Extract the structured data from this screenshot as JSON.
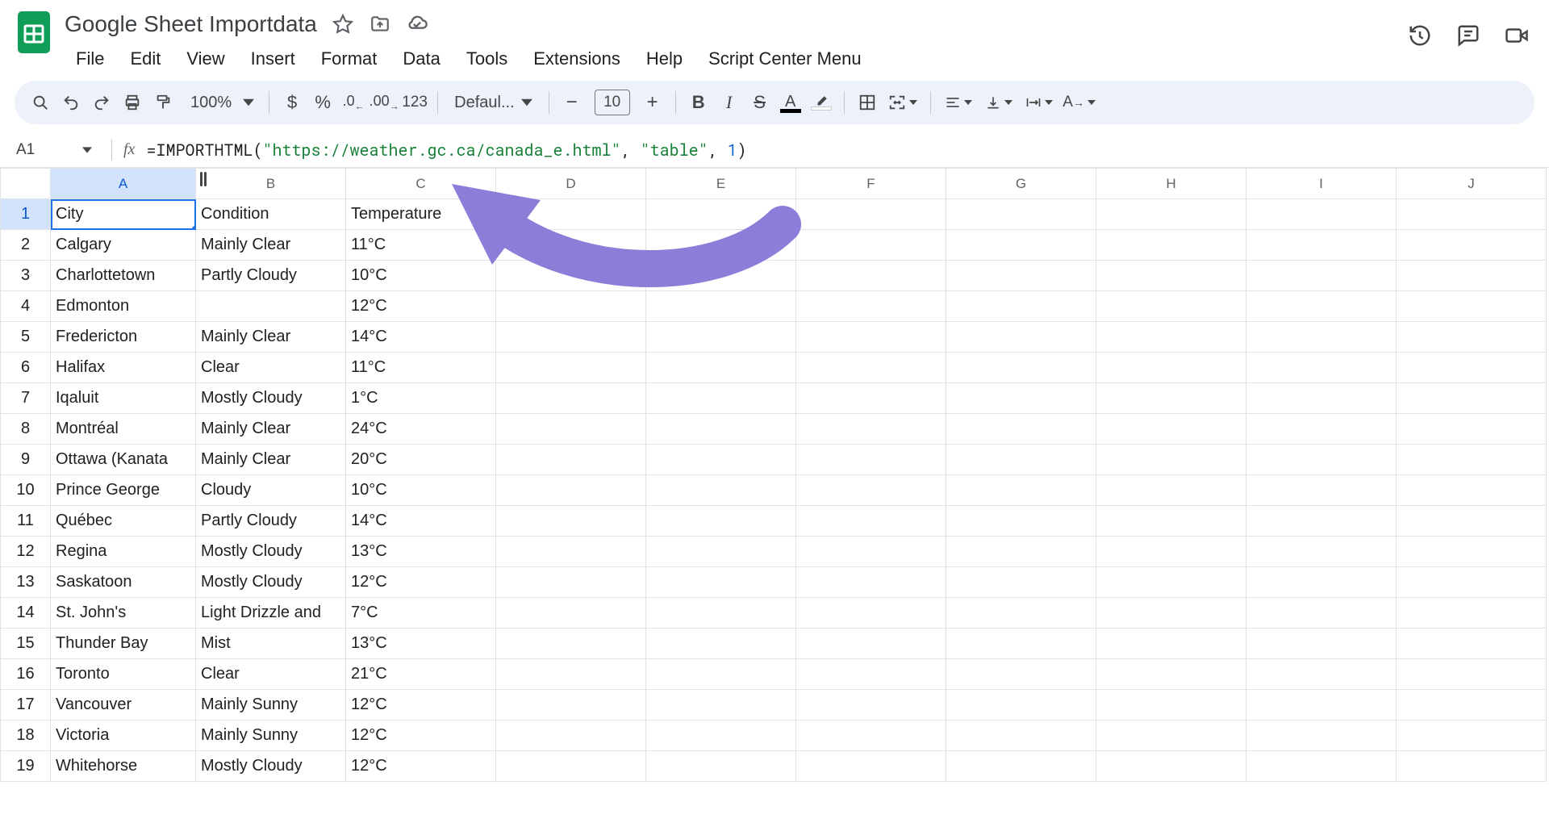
{
  "header": {
    "doc_title": "Google Sheet Importdata",
    "menus": [
      "File",
      "Edit",
      "View",
      "Insert",
      "Format",
      "Data",
      "Tools",
      "Extensions",
      "Help",
      "Script Center Menu"
    ]
  },
  "toolbar": {
    "zoom": "100%",
    "font": "Defaul...",
    "font_size": "10"
  },
  "formula_bar": {
    "name_box": "A1",
    "formula_prefix": "=IMPORTHTML(",
    "formula_arg1": "\"https://weather.gc.ca/canada_e.html\"",
    "formula_sep1": ", ",
    "formula_arg2": "\"table\"",
    "formula_sep2": ", ",
    "formula_arg3": "1",
    "formula_suffix": ")"
  },
  "columns": [
    "A",
    "B",
    "C",
    "D",
    "E",
    "F",
    "G",
    "H",
    "I",
    "J"
  ],
  "rows": [
    {
      "n": "1",
      "a": "City",
      "b": "Condition",
      "c": "Temperature"
    },
    {
      "n": "2",
      "a": "Calgary",
      "b": "Mainly Clear",
      "c": "11°C"
    },
    {
      "n": "3",
      "a": "Charlottetown",
      "b": "Partly Cloudy",
      "c": "10°C"
    },
    {
      "n": "4",
      "a": "Edmonton",
      "b": "",
      "c": "12°C"
    },
    {
      "n": "5",
      "a": "Fredericton",
      "b": "Mainly Clear",
      "c": "14°C"
    },
    {
      "n": "6",
      "a": "Halifax",
      "b": "Clear",
      "c": "11°C"
    },
    {
      "n": "7",
      "a": "Iqaluit",
      "b": "Mostly Cloudy",
      "c": "1°C"
    },
    {
      "n": "8",
      "a": "Montréal",
      "b": "Mainly Clear",
      "c": "24°C"
    },
    {
      "n": "9",
      "a": "Ottawa (Kanata",
      "b": "Mainly Clear",
      "c": "20°C"
    },
    {
      "n": "10",
      "a": "Prince George",
      "b": "Cloudy",
      "c": "10°C"
    },
    {
      "n": "11",
      "a": "Québec",
      "b": "Partly Cloudy",
      "c": "14°C"
    },
    {
      "n": "12",
      "a": "Regina",
      "b": "Mostly Cloudy",
      "c": "13°C"
    },
    {
      "n": "13",
      "a": "Saskatoon",
      "b": "Mostly Cloudy",
      "c": "12°C"
    },
    {
      "n": "14",
      "a": "St. John's",
      "b": "Light Drizzle and",
      "c": "7°C"
    },
    {
      "n": "15",
      "a": "Thunder Bay",
      "b": "Mist",
      "c": "13°C"
    },
    {
      "n": "16",
      "a": "Toronto",
      "b": "Clear",
      "c": "21°C"
    },
    {
      "n": "17",
      "a": "Vancouver",
      "b": "Mainly Sunny",
      "c": "12°C"
    },
    {
      "n": "18",
      "a": "Victoria",
      "b": "Mainly Sunny",
      "c": "12°C"
    },
    {
      "n": "19",
      "a": "Whitehorse",
      "b": "Mostly Cloudy",
      "c": "12°C"
    }
  ]
}
